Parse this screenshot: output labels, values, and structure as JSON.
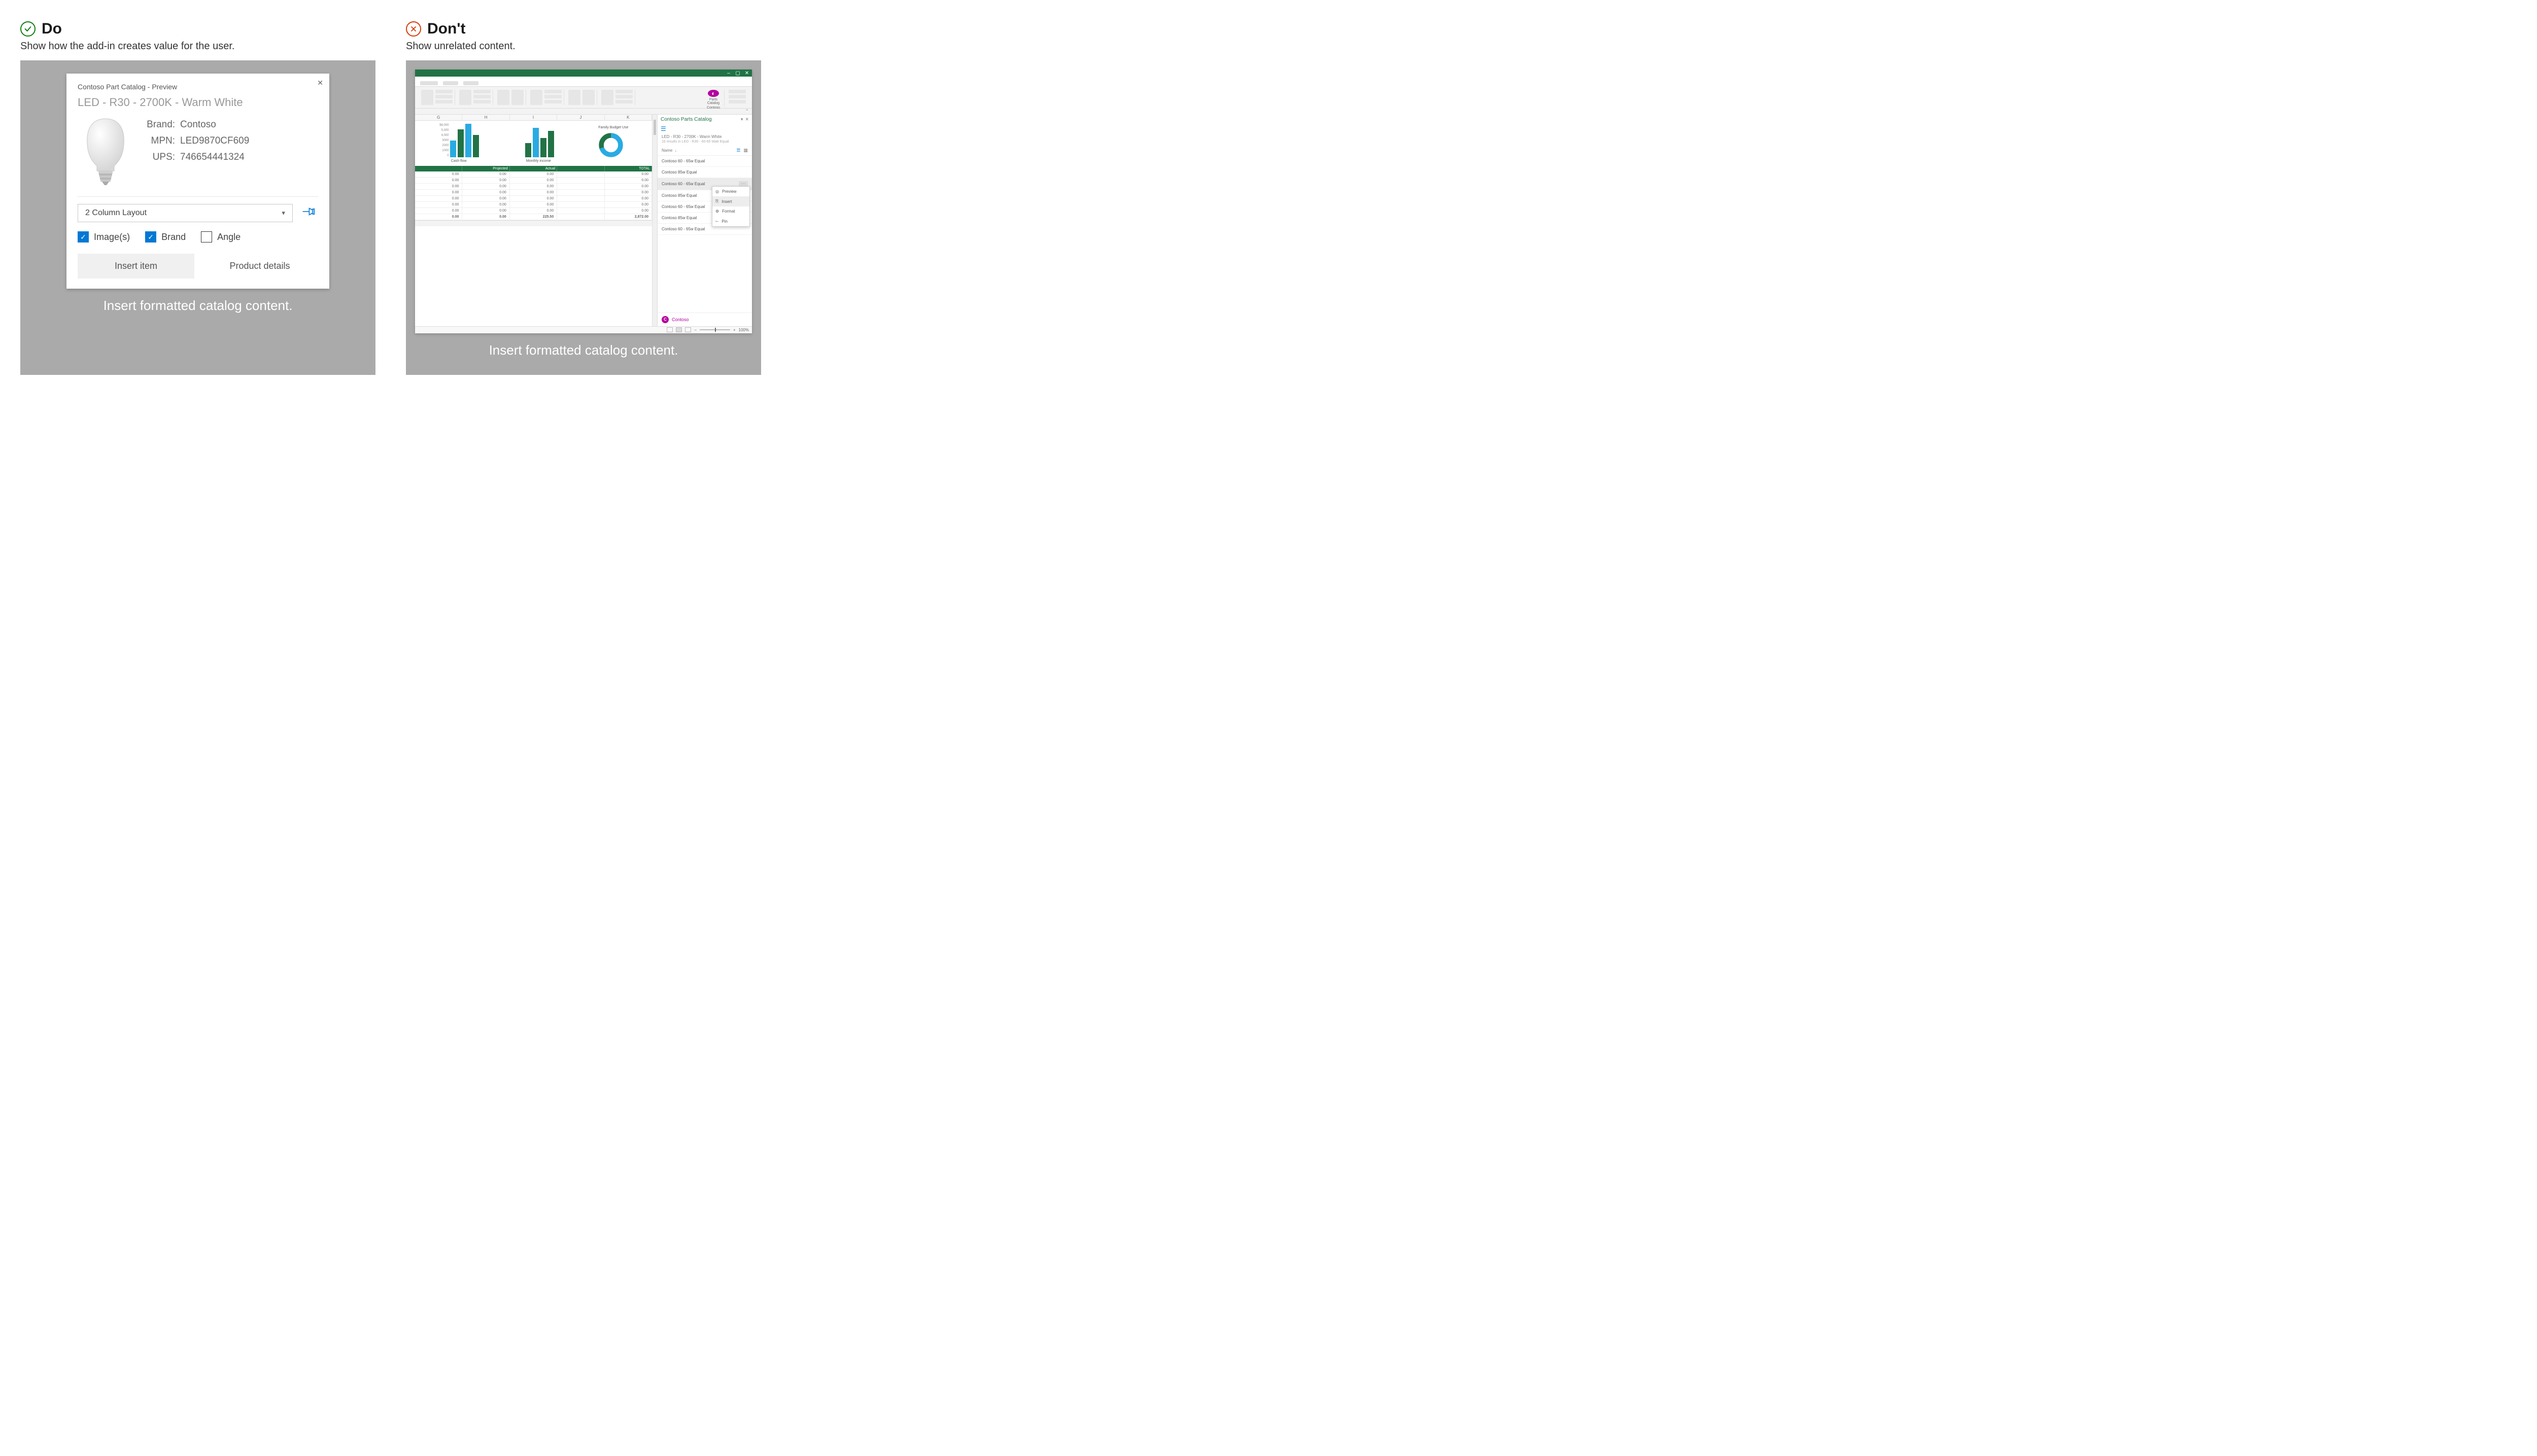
{
  "do": {
    "title": "Do",
    "subtitle": "Show how the add-in creates value for the user.",
    "caption": "Insert formatted catalog content.",
    "card": {
      "windowTitle": "Contoso Part Catalog - Preview",
      "productTitle": "LED - R30 - 2700K - Warm White",
      "attrs": {
        "brandLabel": "Brand:",
        "brand": "Contoso",
        "mpnLabel": "MPN:",
        "mpn": "LED9870CF609",
        "upsLabel": "UPS:",
        "ups": "746654441324"
      },
      "layoutSelect": "2 Column Layout",
      "checks": {
        "images": "Image(s)",
        "brand": "Brand",
        "angle": "Angle"
      },
      "actions": {
        "insert": "Insert item",
        "details": "Product details"
      }
    }
  },
  "dont": {
    "title": "Don't",
    "subtitle": "Show unrelated content.",
    "caption": "Insert formatted catalog content.",
    "excel": {
      "ribbon": {
        "catalogLabel": "Parts Catalog",
        "catalogVendor": "Contoso"
      },
      "columns": [
        "G",
        "H",
        "I",
        "J",
        "K"
      ],
      "chart1": {
        "title": "Cash flow",
        "yTicks": [
          "$6,000",
          "5,000",
          "4,000",
          "3000",
          "2000",
          "1000",
          "0"
        ]
      },
      "chart2": {
        "title": "Monthly income"
      },
      "chart3": {
        "title": "Family Budget Use"
      },
      "tableHeaders": [
        "",
        "Projected",
        "Actual",
        "",
        "TOTAL"
      ],
      "tableRows": [
        [
          "0.00",
          "0.00",
          "0.00",
          "",
          "0.00"
        ],
        [
          "0.00",
          "0.00",
          "0.00",
          "",
          "0.00"
        ],
        [
          "0.00",
          "0.00",
          "0.00",
          "",
          "0.00"
        ],
        [
          "0.00",
          "0.00",
          "0.00",
          "",
          "0.00"
        ],
        [
          "0.00",
          "0.00",
          "0.00",
          "",
          "0.00"
        ],
        [
          "0.00",
          "0.00",
          "0.00",
          "",
          "0.00"
        ],
        [
          "0.00",
          "0.00",
          "0.00",
          "",
          "0.00"
        ]
      ],
      "tableTotals": [
        "0.00",
        "0.00",
        "225.50",
        "",
        "2,872.00"
      ],
      "zoomLabel": "100%",
      "taskpane": {
        "title": "Contoso Parts Catalog",
        "breadcrumb": "LED - R30 - 2700K - Warm White",
        "resultCount": "16 results in LED - R30 - 60-65 Watt Equal",
        "sortLabel": "Name",
        "items": [
          "Contoso 60 - 65w Equal",
          "Contoso 85w Equal",
          "Contoso 60 - 65w Equal",
          "Contoso 85w Equal",
          "Contoso 60 - 65w Equal",
          "Contoso 85w Equal",
          "Contoso 60 - 65w Equal"
        ],
        "contextMenu": {
          "preview": "Preview",
          "insert": "Insert",
          "format": "Format",
          "pin": "Pin"
        },
        "footerVendor": "Contoso"
      }
    }
  },
  "chart_data": [
    {
      "type": "bar",
      "title": "Cash flow",
      "categories": [
        "b1",
        "b2",
        "b3",
        "b4"
      ],
      "values": [
        3000,
        5000,
        6000,
        4000
      ],
      "ylim": [
        0,
        6000
      ]
    },
    {
      "type": "bar",
      "title": "Monthly income",
      "categories": [
        "b1",
        "b2",
        "b3",
        "b4"
      ],
      "values": [
        2500,
        5500,
        3500,
        4800
      ],
      "ylim": [
        0,
        6000
      ]
    },
    {
      "type": "pie",
      "title": "Family Budget Use",
      "categories": [
        "Used",
        "Remaining"
      ],
      "values": [
        70,
        30
      ]
    }
  ]
}
